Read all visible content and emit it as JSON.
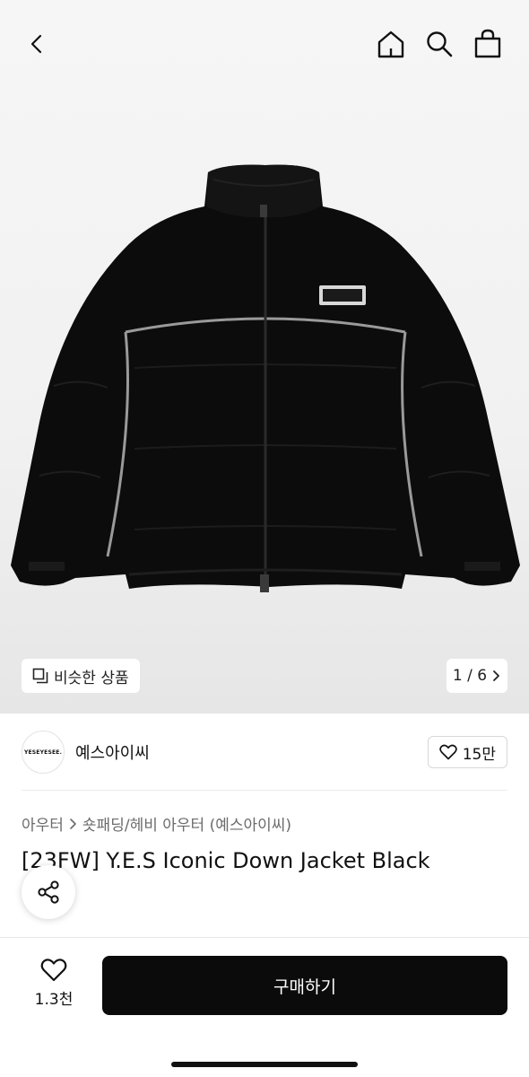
{
  "header": {
    "back_icon": "chevron-left-icon",
    "home_icon": "home-icon",
    "search_icon": "search-icon",
    "cart_icon": "shopping-bag-icon"
  },
  "hero": {
    "similar_label": "비슷한 상품",
    "pager_text": "1 / 6",
    "product_image": "black-puffer-jacket"
  },
  "brand": {
    "logo_text": "YESEYESEE.",
    "name": "예스아이씨",
    "like_count": "15만"
  },
  "breadcrumb": {
    "level1": "아우터",
    "level2": "숏패딩/헤비 아우터 (예스아이씨)"
  },
  "product": {
    "title": "[23FW] Y.E.S Iconic Down Jacket Black"
  },
  "bottom": {
    "wish_count": "1.3천",
    "buy_label": "구매하기"
  }
}
